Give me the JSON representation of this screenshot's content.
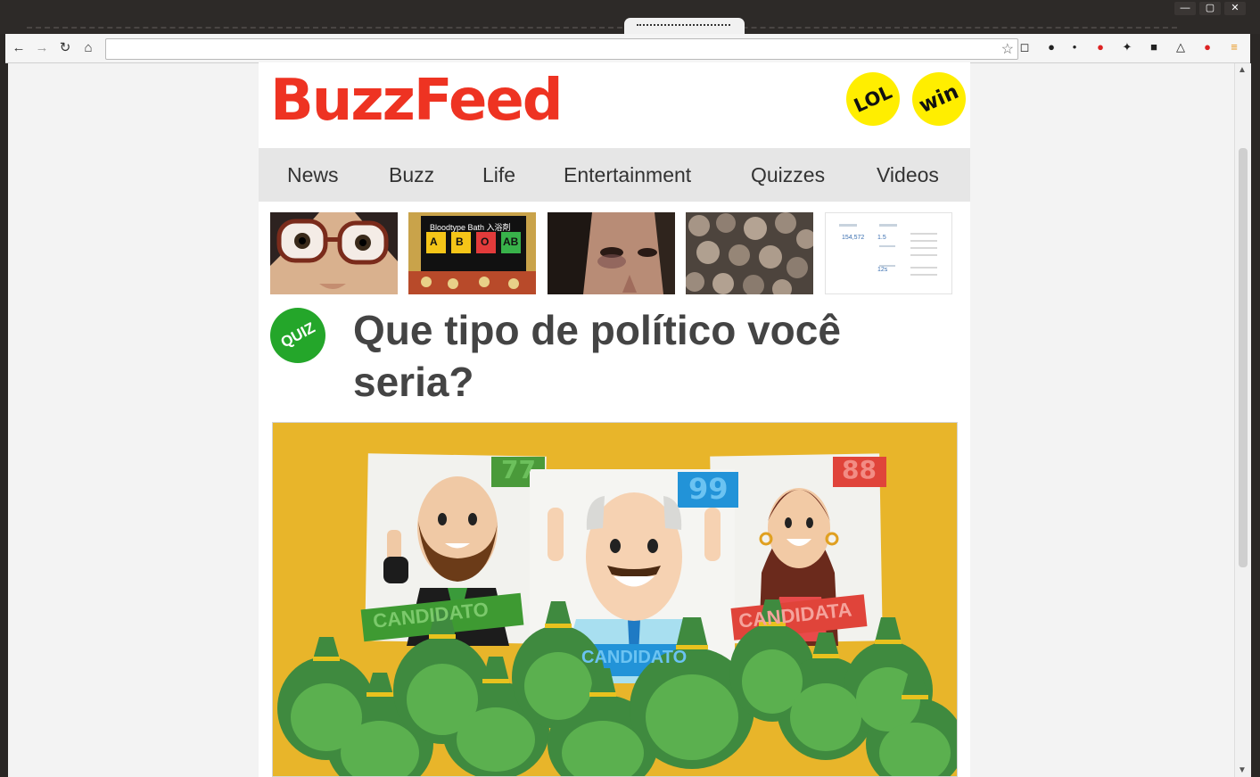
{
  "window": {
    "controls": [
      "—",
      "▢",
      "✕"
    ]
  },
  "toolbar": {
    "back_icon": "back-arrow-icon",
    "forward_icon": "forward-arrow-icon",
    "reload_icon": "reload-icon",
    "home_icon": "home-icon",
    "address": ""
  },
  "site": {
    "logo": "BuzzFeed",
    "badges": [
      "LOL",
      "win"
    ],
    "brand_color": "#ee3322",
    "badge_color": "#ffee00"
  },
  "nav": {
    "items": [
      "News",
      "Buzz",
      "Life",
      "Entertainment",
      "Quizzes",
      "Videos"
    ]
  },
  "thumbnails": {
    "t2_caption": "Bloodtype Bath 入浴剤",
    "t2_letters": [
      "A",
      "B",
      "O",
      "AB"
    ],
    "t5_stats": [
      "154,572",
      "1.5",
      "12s"
    ]
  },
  "article": {
    "badge": "QUIZ",
    "title": "Que tipo de político você seria?",
    "quiz_color": "#24a62a"
  },
  "hero": {
    "numbers": [
      "77",
      "99",
      "88"
    ],
    "banners": [
      "CANDIDATO",
      "CANDIDATO",
      "CANDIDATA"
    ],
    "background": "#e8b52a"
  }
}
